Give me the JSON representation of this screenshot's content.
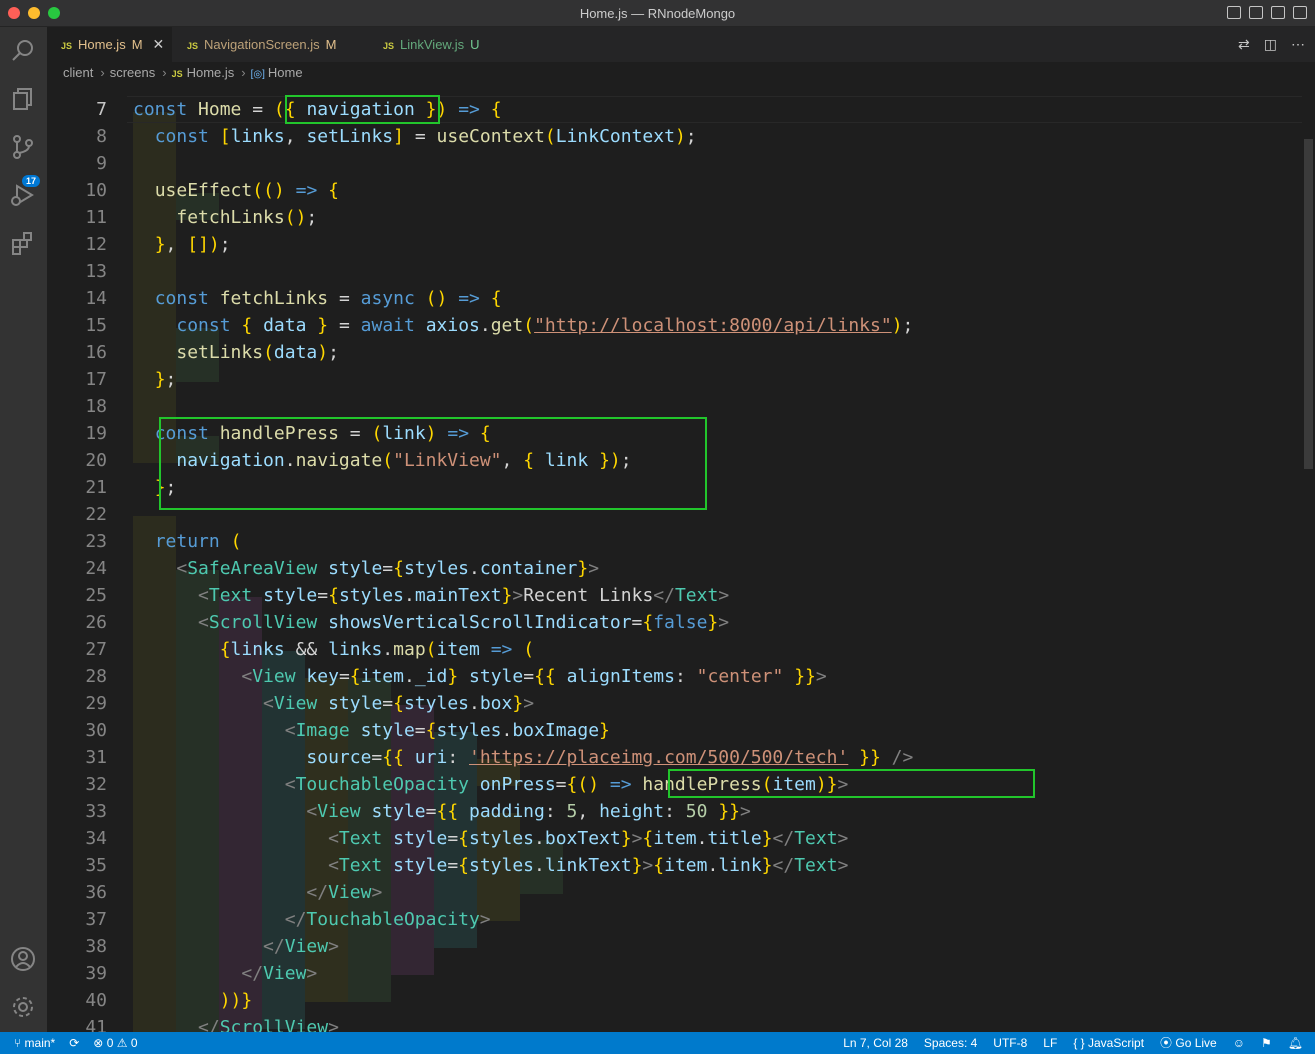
{
  "window": {
    "title": "Home.js — RNnodeMongo"
  },
  "tabs": [
    {
      "label": "Home.js",
      "status": "M",
      "icon": "js-icon"
    },
    {
      "label": "NavigationScreen.js",
      "status": "M",
      "icon": "js-icon"
    },
    {
      "label": "LinkView.js",
      "status": "U",
      "icon": "js-icon"
    }
  ],
  "breadcrumb": {
    "items": [
      "client",
      "screens",
      "Home.js",
      "Home"
    ]
  },
  "activity_bar": {
    "scm_badge": "17"
  },
  "editor": {
    "line_numbers": [
      "7",
      "8",
      "9",
      "10",
      "11",
      "12",
      "13",
      "14",
      "15",
      "16",
      "17",
      "18",
      "19",
      "20",
      "21",
      "22",
      "23",
      "24",
      "25",
      "26",
      "27",
      "28",
      "29",
      "30",
      "31",
      "32",
      "33",
      "34",
      "35",
      "36",
      "37",
      "38",
      "39",
      "40",
      "41"
    ],
    "code_lines": [
      "const Home = ({ navigation }) => {",
      "  const [links, setLinks] = useContext(LinkContext);",
      "",
      "  useEffect(() => {",
      "    fetchLinks();",
      "  }, []);",
      "",
      "  const fetchLinks = async () => {",
      "    const { data } = await axios.get(\"http://localhost:8000/api/links\");",
      "    setLinks(data);",
      "  };",
      "",
      "  const handlePress = (link) => {",
      "    navigation.navigate(\"LinkView\", { link });",
      "  };",
      "",
      "  return (",
      "    <SafeAreaView style={styles.container}>",
      "      <Text style={styles.mainText}>Recent Links</Text>",
      "      <ScrollView showsVerticalScrollIndicator={false}>",
      "        {links && links.map(item => (",
      "          <View key={item._id} style={{ alignItems: \"center\" }}>",
      "            <View style={styles.box}>",
      "              <Image style={styles.boxImage}",
      "                source={{ uri: 'https://placeimg.com/500/500/tech' }} />",
      "              <TouchableOpacity onPress={() => handlePress(item)}>",
      "                <View style={{ padding: 5, height: 50 }}>",
      "                  <Text style={styles.boxText}>{item.title}</Text>",
      "                  <Text style={styles.linkText}>{item.link}</Text>",
      "                </View>",
      "              </TouchableOpacity>",
      "            </View>",
      "          </View>",
      "        ))}",
      "      </ScrollView>"
    ]
  },
  "statusbar": {
    "branch": "main*",
    "errors": "0",
    "warnings": "0",
    "position": "Ln 7, Col 28",
    "spaces": "Spaces: 4",
    "encoding": "UTF-8",
    "eol": "LF",
    "language": "JavaScript",
    "golive": "Go Live"
  },
  "colors": {
    "highlight_box": "#22c52c",
    "statusbar": "#007acc",
    "accent": "#0078d4"
  }
}
